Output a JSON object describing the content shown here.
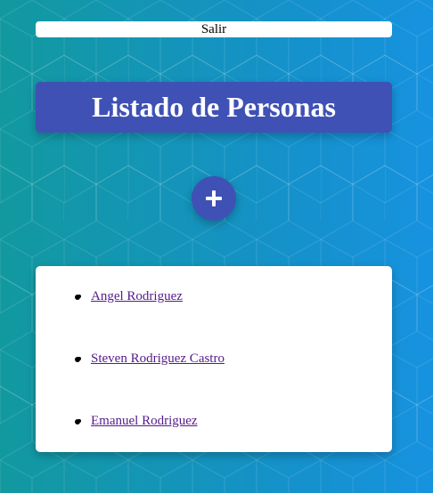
{
  "header": {
    "logout_label": "Salir"
  },
  "page": {
    "title": "Listado de Personas",
    "add_button_icon": "plus-icon"
  },
  "people": [
    {
      "name": "Angel Rodriguez"
    },
    {
      "name": "Steven Rodriguez Castro"
    },
    {
      "name": "Emanuel Rodriguez"
    }
  ],
  "colors": {
    "background_start": "#12999f",
    "background_end": "#1792df",
    "primary": "#3f51b5",
    "card": "#ffffff",
    "link_visited": "#551a8b"
  }
}
